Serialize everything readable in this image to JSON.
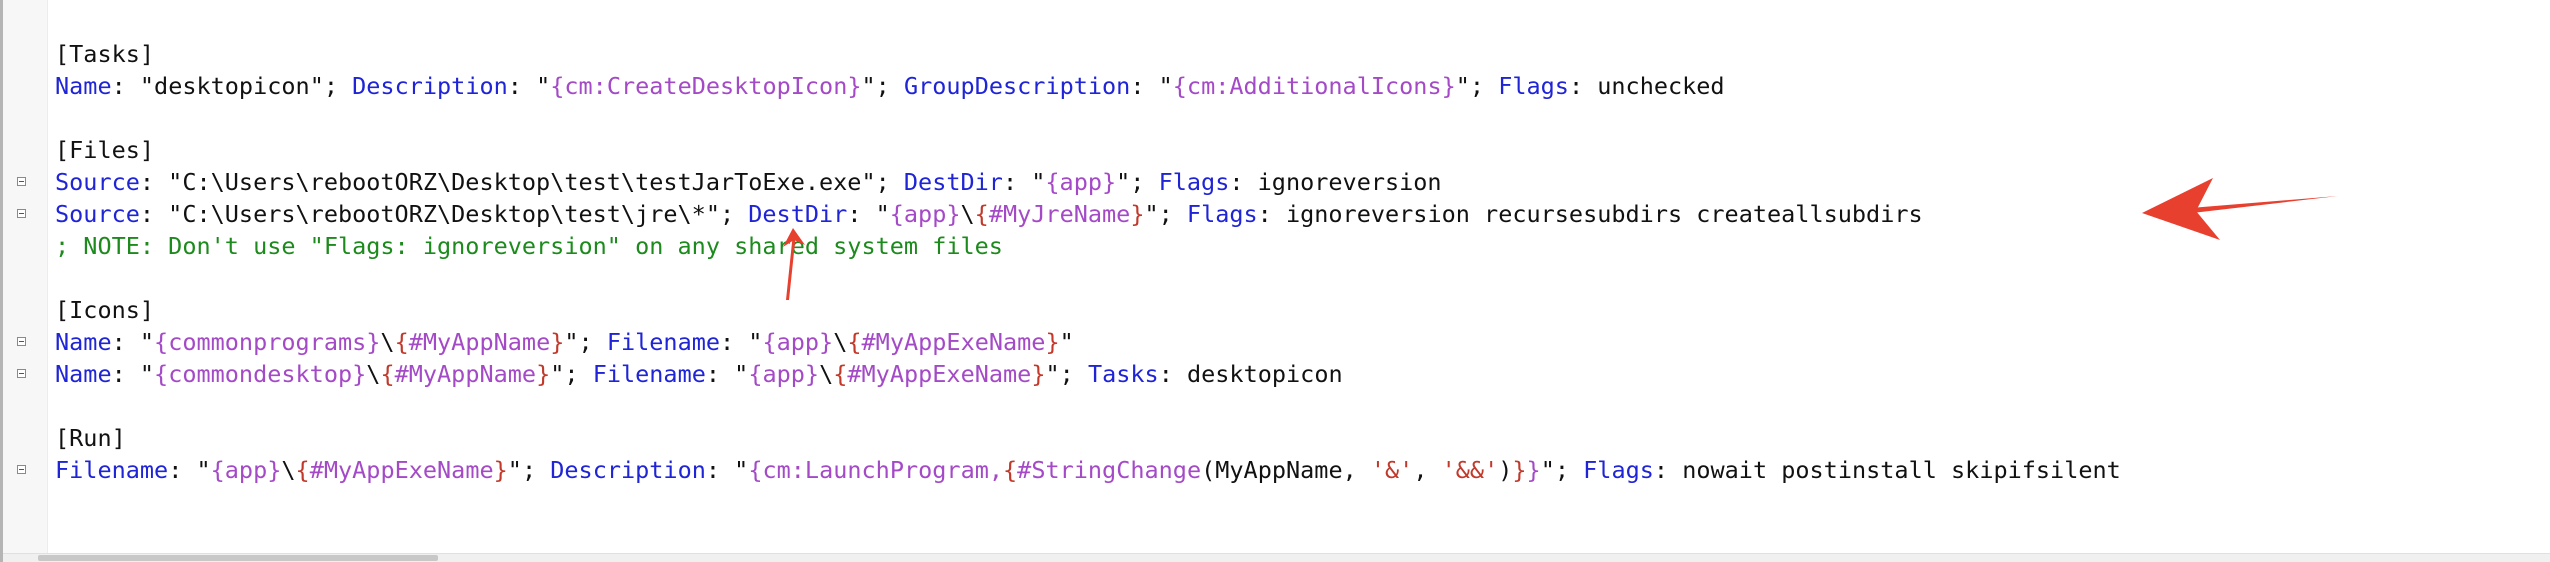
{
  "editor": {
    "lines": [
      [
        {
          "c": "sec",
          "t": "[Tasks]"
        }
      ],
      [
        {
          "c": "k",
          "t": "Name"
        },
        {
          "c": "p",
          "t": ": \""
        },
        {
          "c": "p",
          "t": "desktopicon"
        },
        {
          "c": "p",
          "t": "\"; "
        },
        {
          "c": "k",
          "t": "Description"
        },
        {
          "c": "p",
          "t": ": \""
        },
        {
          "c": "c",
          "t": "{cm:CreateDesktopIcon}"
        },
        {
          "c": "p",
          "t": "\"; "
        },
        {
          "c": "k",
          "t": "GroupDescription"
        },
        {
          "c": "p",
          "t": ": \""
        },
        {
          "c": "c",
          "t": "{cm:AdditionalIcons}"
        },
        {
          "c": "p",
          "t": "\"; "
        },
        {
          "c": "k",
          "t": "Flags"
        },
        {
          "c": "p",
          "t": ": unchecked"
        }
      ],
      [],
      [
        {
          "c": "sec",
          "t": "[Files]"
        }
      ],
      [
        {
          "c": "k",
          "t": "Source"
        },
        {
          "c": "p",
          "t": ": \"C:\\Users\\rebootORZ\\Desktop\\test\\testJarToExe.exe\"; "
        },
        {
          "c": "k",
          "t": "DestDir"
        },
        {
          "c": "p",
          "t": ": \""
        },
        {
          "c": "c",
          "t": "{app}"
        },
        {
          "c": "p",
          "t": "\"; "
        },
        {
          "c": "k",
          "t": "Flags"
        },
        {
          "c": "p",
          "t": ": ignoreversion"
        }
      ],
      [
        {
          "c": "k",
          "t": "Source"
        },
        {
          "c": "p",
          "t": ": \"C:\\Users\\rebootORZ\\Desktop\\test\\jre\\*\"; "
        },
        {
          "c": "k",
          "t": "DestDir"
        },
        {
          "c": "p",
          "t": ": \""
        },
        {
          "c": "c",
          "t": "{app}"
        },
        {
          "c": "p",
          "t": "\\"
        },
        {
          "c": "s",
          "t": "{"
        },
        {
          "c": "c",
          "t": "#MyJreName"
        },
        {
          "c": "s",
          "t": "}"
        },
        {
          "c": "p",
          "t": "\"; "
        },
        {
          "c": "k",
          "t": "Flags"
        },
        {
          "c": "p",
          "t": ": ignoreversion recursesubdirs createallsubdirs"
        }
      ],
      [
        {
          "c": "cm",
          "t": "; NOTE: Don't use \"Flags: ignoreversion\" on any shared system files"
        }
      ],
      [],
      [
        {
          "c": "sec",
          "t": "[Icons]"
        }
      ],
      [
        {
          "c": "k",
          "t": "Name"
        },
        {
          "c": "p",
          "t": ": \""
        },
        {
          "c": "c",
          "t": "{commonprograms}"
        },
        {
          "c": "p",
          "t": "\\"
        },
        {
          "c": "s",
          "t": "{"
        },
        {
          "c": "c",
          "t": "#MyAppName"
        },
        {
          "c": "s",
          "t": "}"
        },
        {
          "c": "p",
          "t": "\"; "
        },
        {
          "c": "k",
          "t": "Filename"
        },
        {
          "c": "p",
          "t": ": \""
        },
        {
          "c": "c",
          "t": "{app}"
        },
        {
          "c": "p",
          "t": "\\"
        },
        {
          "c": "s",
          "t": "{"
        },
        {
          "c": "c",
          "t": "#MyAppExeName"
        },
        {
          "c": "s",
          "t": "}"
        },
        {
          "c": "p",
          "t": "\""
        }
      ],
      [
        {
          "c": "k",
          "t": "Name"
        },
        {
          "c": "p",
          "t": ": \""
        },
        {
          "c": "c",
          "t": "{commondesktop}"
        },
        {
          "c": "p",
          "t": "\\"
        },
        {
          "c": "s",
          "t": "{"
        },
        {
          "c": "c",
          "t": "#MyAppName"
        },
        {
          "c": "s",
          "t": "}"
        },
        {
          "c": "p",
          "t": "\"; "
        },
        {
          "c": "k",
          "t": "Filename"
        },
        {
          "c": "p",
          "t": ": \""
        },
        {
          "c": "c",
          "t": "{app}"
        },
        {
          "c": "p",
          "t": "\\"
        },
        {
          "c": "s",
          "t": "{"
        },
        {
          "c": "c",
          "t": "#MyAppExeName"
        },
        {
          "c": "s",
          "t": "}"
        },
        {
          "c": "p",
          "t": "\"; "
        },
        {
          "c": "k",
          "t": "Tasks"
        },
        {
          "c": "p",
          "t": ": desktopicon"
        }
      ],
      [],
      [
        {
          "c": "sec",
          "t": "[Run]"
        }
      ],
      [
        {
          "c": "k",
          "t": "Filename"
        },
        {
          "c": "p",
          "t": ": \""
        },
        {
          "c": "c",
          "t": "{app}"
        },
        {
          "c": "p",
          "t": "\\"
        },
        {
          "c": "s",
          "t": "{"
        },
        {
          "c": "c",
          "t": "#MyAppExeName"
        },
        {
          "c": "s",
          "t": "}"
        },
        {
          "c": "p",
          "t": "\"; "
        },
        {
          "c": "k",
          "t": "Description"
        },
        {
          "c": "p",
          "t": ": \""
        },
        {
          "c": "c",
          "t": "{cm:LaunchProgram,"
        },
        {
          "c": "s",
          "t": "{"
        },
        {
          "c": "c",
          "t": "#StringChange"
        },
        {
          "c": "p",
          "t": "(MyAppName, "
        },
        {
          "c": "s",
          "t": "'&'"
        },
        {
          "c": "p",
          "t": ", "
        },
        {
          "c": "s",
          "t": "'&&'"
        },
        {
          "c": "p",
          "t": ")"
        },
        {
          "c": "s",
          "t": "}"
        },
        {
          "c": "c",
          "t": "}"
        },
        {
          "c": "p",
          "t": "\"; "
        },
        {
          "c": "k",
          "t": "Flags"
        },
        {
          "c": "p",
          "t": ": nowait postinstall skipifsilent"
        }
      ]
    ],
    "fold_markers_at_lines": [
      4,
      5,
      9,
      10,
      13
    ]
  },
  "colors": {
    "keyword": "#1f24d6",
    "constant": "#a44ac7",
    "brace": "#c0392b",
    "comment": "#1d8a1d",
    "text": "#111111",
    "annotation_arrow": "#e8402f"
  },
  "annotations": {
    "arrows": [
      {
        "name": "arrow-right-pointing-to-flags",
        "icon": "red-arrow-icon"
      },
      {
        "name": "arrow-up-pointing-to-wildcard",
        "icon": "red-arrow-icon"
      }
    ]
  }
}
